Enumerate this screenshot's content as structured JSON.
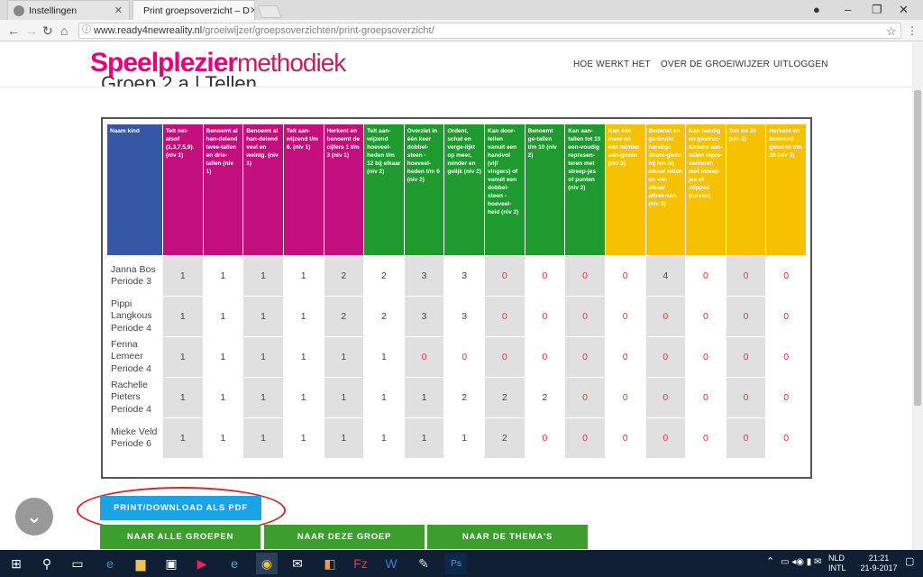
{
  "browser": {
    "tabs": [
      {
        "label": "Instellingen"
      },
      {
        "label": "Print groepsoverzicht – D"
      }
    ],
    "window_controls": [
      "–",
      "❐",
      "✕"
    ],
    "url_host": "www.ready4newreality.nl",
    "url_path": "/groeiwijzer/groepsoverzichten/print-groepsoverzicht/"
  },
  "header": {
    "logo_part1": "Speelplezier",
    "logo_part2": "methodiek",
    "nav": [
      "HOE WERKT HET",
      "OVER DE GROEIWIJZER",
      "UITLOGGEN"
    ],
    "page_title": "Groep 2 a | Tellen"
  },
  "table": {
    "headers": [
      {
        "text": "Naam kind",
        "color": "#3656a6"
      },
      {
        "text": "Telt net-alsof (1,3,7,5,9). (niv 1)",
        "color": "#c30e7d"
      },
      {
        "text": "Benoemt al han-delend twee-tallen en drie-tallen (niv 1)",
        "color": "#c30e7d"
      },
      {
        "text": "Benoemt al han-delend veel en weinig. (niv 1)",
        "color": "#c30e7d"
      },
      {
        "text": "Telt aan-wijzend t/m 6. (niv 1)",
        "color": "#c30e7d"
      },
      {
        "text": "Herkent en benoemt de cijfers 1 t/m 3 (niv 1)",
        "color": "#c30e7d"
      },
      {
        "text": "Telt aan-wijzend hoeveel-heden t/m 12 bij elkaar (niv 2)",
        "color": "#1e9a2e"
      },
      {
        "text": "Overziet in één keer dobbel-steen - hoeveel-heden t/m 6 (niv 2)",
        "color": "#1e9a2e"
      },
      {
        "text": "Ordent, schat en verge-lijkt op meer, minder en gelijk (niv 2)",
        "color": "#1e9a2e"
      },
      {
        "text": "Kan door-tellen vanuit een handvol (vijf vingers) of vanuit een dobbel-steen - hoeveel-heid (niv 2)",
        "color": "#1e9a2e"
      },
      {
        "text": "Benoemt ge-tallen t/m 10 (niv 2)",
        "color": "#1e9a2e"
      },
      {
        "text": "Kan aan-tallen tot 10 een-voudig represen-teren met streep-jes of punten (niv 2)",
        "color": "#1e9a2e"
      },
      {
        "text": "Kan één meer en één minder aan-geven (niv 3)",
        "color": "#f6c100"
      },
      {
        "text": "Bedenkt en ge-bruikt handige strate-gieën bij het bij elkaar tellen en van elkaar aftrek-ken (niv 3)",
        "color": "#f6c100"
      },
      {
        "text": "Kan handig en gestruc-tureerd aan-tallen repre-senteren met streep-jes of stippen (turven)",
        "color": "#f6c100"
      },
      {
        "text": "Telt tot 20 (niv 3)",
        "color": "#f6c100"
      },
      {
        "text": "Herkent en benoemt getallen t/m 20 (niv 3)",
        "color": "#f6c100"
      }
    ],
    "rows": [
      {
        "name": "Janna Bos Periode 3",
        "values": [
          "1",
          "1",
          "1",
          "1",
          "2",
          "2",
          "3",
          "3",
          "0",
          "0",
          "0",
          "0",
          "4",
          "0",
          "0",
          "0"
        ]
      },
      {
        "name": "Pippi Langkous Periode 4",
        "values": [
          "1",
          "1",
          "1",
          "1",
          "2",
          "2",
          "3",
          "3",
          "0",
          "0",
          "0",
          "0",
          "0",
          "0",
          "0",
          "0"
        ]
      },
      {
        "name": "Fenna Lemeer Periode 4",
        "values": [
          "1",
          "1",
          "1",
          "1",
          "1",
          "1",
          "0",
          "0",
          "0",
          "0",
          "0",
          "0",
          "0",
          "0",
          "0",
          "0"
        ]
      },
      {
        "name": "Rachelle Pieters Periode 4",
        "values": [
          "1",
          "1",
          "1",
          "1",
          "1",
          "1",
          "1",
          "2",
          "2",
          "2",
          "0",
          "0",
          "0",
          "0",
          "0",
          "0"
        ]
      },
      {
        "name": "Mieke Veld Periode 6",
        "values": [
          "1",
          "1",
          "1",
          "1",
          "1",
          "1",
          "1",
          "1",
          "2",
          "0",
          "0",
          "0",
          "0",
          "0",
          "0",
          "0"
        ]
      }
    ]
  },
  "buttons": {
    "pdf": "PRINT/DOWNLOAD ALS PDF",
    "green": [
      "NAAR ALLE GROEPEN",
      "NAAR DEZE GROEP",
      "NAAR DE THEMA'S"
    ]
  },
  "taskbar": {
    "lang1": "NLD",
    "lang2": "INTL",
    "time": "21:21",
    "date": "21-9-2017"
  },
  "colors": {
    "red_value": "#e33333",
    "pdf_button": "#1ba3e7",
    "green_button": "#3b9e2d"
  }
}
